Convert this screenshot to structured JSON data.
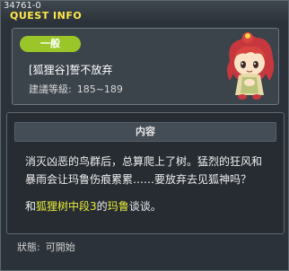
{
  "window": {
    "quest_id": "34761-0",
    "title": "QUEST INFO"
  },
  "header": {
    "category_badge": "一般",
    "quest_name": "[狐狸谷]誓不放弃",
    "level_label": "建議等級:",
    "level_range": "185~189"
  },
  "content": {
    "section_title": "内容",
    "description_line1": "消灭凶恶的鸟群后，总算爬上了树。猛烈的狂风和",
    "description_line2": "暴雨会让玛鲁伤痕累累……要放弃去见狐神吗？",
    "objective_prefix": "和",
    "objective_place": "狐狸树中段",
    "objective_number": "3",
    "objective_of": "的",
    "objective_npc": "玛鲁",
    "objective_suffix": "谈谈。"
  },
  "footer": {
    "status_label": "狀態:",
    "status_value": "可開始"
  },
  "colors": {
    "accent_title": "#ffe84a",
    "badge_green": "#9ac62a",
    "highlight_yellow": "#e8ed3b"
  },
  "icons": {
    "npc_portrait": "npc-maru-portrait"
  }
}
